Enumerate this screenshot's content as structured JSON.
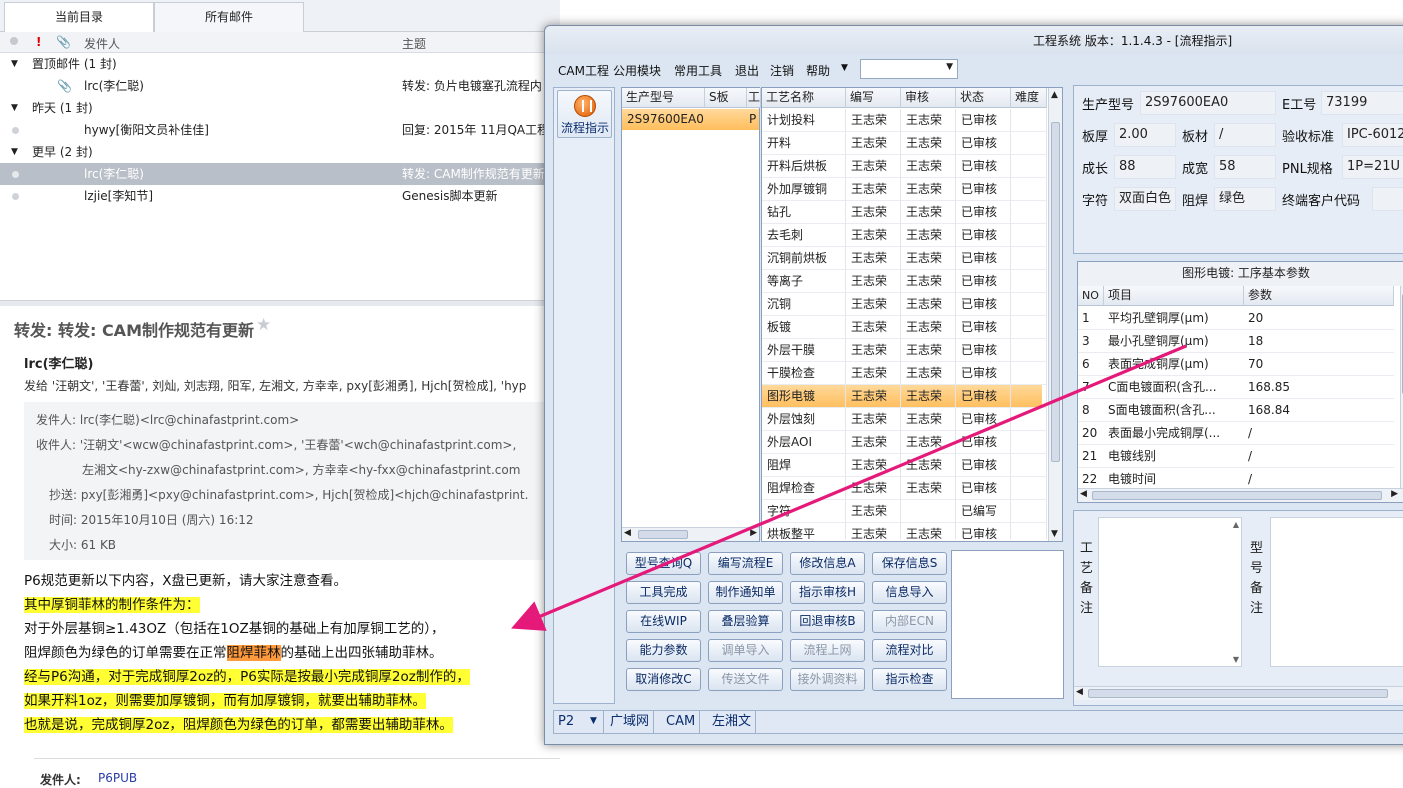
{
  "mail": {
    "tabs": [
      "当前目录",
      "所有邮件"
    ],
    "columns": {
      "sender": "发件人",
      "subject": "主题"
    },
    "groups": [
      {
        "label": "置顶邮件 (1 封)"
      },
      {
        "label": "昨天 (1 封)"
      },
      {
        "label": "更早 (2 封)"
      }
    ],
    "rows": [
      {
        "sender": "lrc(李仁聪)",
        "subject": "转发: 负片电镀塞孔流程内"
      },
      {
        "sender": "hywy[衡阳文员补佳佳]",
        "subject": "回复: 2015年 11月QA工程"
      },
      {
        "sender": "lrc(李仁聪)",
        "subject": "转发: CAM制作规范有更新"
      },
      {
        "sender": "lzjie[李知节]",
        "subject": "Genesis脚本更新"
      }
    ],
    "reading": {
      "subject": "转发: 转发: CAM制作规范有更新",
      "from": "lrc(李仁聪)",
      "to_line": "发给 '汪朝文', '王春蕾', 刘灿, 刘志翔, 阳军, 左湘文, 方幸幸, pxy[彭湘勇], Hjch[贺检成], 'hyp",
      "meta": {
        "sender": "发件人: lrc(李仁聪)<lrc@chinafastprint.com>",
        "recipients1": "收件人: '汪朝文'<wcw@chinafastprint.com>, '王春蕾'<wch@chinafastprint.com>,",
        "recipients2": "左湘文<hy-zxw@chinafastprint.com>, 方幸幸<hy-fxx@chinafastprint.com",
        "cc": "抄送: pxy[彭湘勇]<pxy@chinafastprint.com>, Hjch[贺检成]<hjch@chinafastprint.",
        "time": "时间: 2015年10月10日 (周六) 16:12",
        "size": "大小: 61 KB"
      },
      "body": {
        "l1": "P6规范更新以下内容，X盘已更新，请大家注意查看。",
        "l2": "其中厚铜菲林的制作条件为：",
        "l3": "对于外层基铜≥1.43OZ（包括在1OZ基铜的基础上有加厚铜工艺的），",
        "l4a": "阻焊颜色为绿色的订单需要在正常",
        "l4b": "阻焊菲林",
        "l4c": "的基础上出四张辅助菲林。",
        "l5": "经与P6沟通，对于完成铜厚2oz的，P6实际是按最小完成铜厚2oz制作的，",
        "l6": "如果开料1oz，则需要加厚镀铜，而有加厚镀铜，就要出辅助菲林。",
        "l7": "也就是说，完成铜厚2oz，阻焊颜色为绿色的订单，都需要出辅助菲林。"
      },
      "footer_label": "发件人:",
      "footer_value": "P6PUB"
    }
  },
  "app": {
    "title": "工程系统  版本：1.1.4.3 - [流程指示]",
    "menu": [
      "CAM工程",
      "公用模块",
      "常用工具",
      "退出",
      "注销",
      "帮助"
    ],
    "flow_button": "流程指示",
    "model_table": {
      "headers": [
        "生产型号",
        "S板",
        "工"
      ],
      "rows": [
        {
          "model": "2S97600EA0",
          "extra": "P"
        }
      ]
    },
    "process_table": {
      "headers": [
        "工艺名称",
        "编写",
        "审核",
        "状态",
        "难度"
      ],
      "rows": [
        [
          "计划投料",
          "王志荣",
          "王志荣",
          "已审核"
        ],
        [
          "开料",
          "王志荣",
          "王志荣",
          "已审核"
        ],
        [
          "开料后烘板",
          "王志荣",
          "王志荣",
          "已审核"
        ],
        [
          "外加厚镀铜",
          "王志荣",
          "王志荣",
          "已审核"
        ],
        [
          "钻孔",
          "王志荣",
          "王志荣",
          "已审核"
        ],
        [
          "去毛刺",
          "王志荣",
          "王志荣",
          "已审核"
        ],
        [
          "沉铜前烘板",
          "王志荣",
          "王志荣",
          "已审核"
        ],
        [
          "等离子",
          "王志荣",
          "王志荣",
          "已审核"
        ],
        [
          "沉铜",
          "王志荣",
          "王志荣",
          "已审核"
        ],
        [
          "板镀",
          "王志荣",
          "王志荣",
          "已审核"
        ],
        [
          "外层干膜",
          "王志荣",
          "王志荣",
          "已审核"
        ],
        [
          "干膜检查",
          "王志荣",
          "王志荣",
          "已审核"
        ],
        [
          "图形电镀",
          "王志荣",
          "王志荣",
          "已审核"
        ],
        [
          "外层蚀刻",
          "王志荣",
          "王志荣",
          "已审核"
        ],
        [
          "外层AOI",
          "王志荣",
          "王志荣",
          "已审核"
        ],
        [
          "阻焊",
          "王志荣",
          "王志荣",
          "已审核"
        ],
        [
          "阻焊检查",
          "王志荣",
          "王志荣",
          "已审核"
        ],
        [
          "字符",
          "王志荣",
          "",
          "已编写"
        ],
        [
          "烘板整平",
          "王志荣",
          "王志荣",
          "已审核"
        ]
      ],
      "selected_index": 12
    },
    "buttons": [
      [
        "型号查询Q",
        "编写流程E",
        "修改信息A",
        "保存信息S"
      ],
      [
        "工具完成",
        "制作通知单",
        "指示审核H",
        "信息导入"
      ],
      [
        "在线WIP",
        "叠层验算",
        "回退审核B",
        "内部ECN"
      ],
      [
        "能力参数",
        "调单导入",
        "流程上网",
        "流程对比"
      ],
      [
        "取消修改C",
        "传送文件",
        "接外调资料",
        "指示检查"
      ]
    ],
    "disabled_buttons": [
      "内部ECN",
      "调单导入",
      "流程上网",
      "传送文件",
      "接外调资料"
    ],
    "info": {
      "model_label": "生产型号",
      "model": "2S97600EA0",
      "eno_label": "E工号",
      "eno": "73199",
      "thick_label": "板厚",
      "thick": "2.00",
      "material_label": "板材",
      "material": "/",
      "std_label": "验收标准",
      "std": "IPC-6012",
      "len_label": "成长",
      "len": "88",
      "wid_label": "成宽",
      "wid": "58",
      "pnl_label": "PNL规格",
      "pnl": "1P=21U",
      "char_label": "字符",
      "char": "双面白色",
      "mask_label": "阻焊",
      "mask": "绿色",
      "cust_label": "终端客户代码",
      "cust": ""
    },
    "param_table": {
      "title": "图形电镀: 工序基本参数",
      "headers": [
        "NO",
        "项目",
        "参数"
      ],
      "rows": [
        [
          "1",
          "平均孔壁铜厚(μm)",
          "20"
        ],
        [
          "3",
          "最小孔壁铜厚(μm)",
          "18"
        ],
        [
          "6",
          "表面完成铜厚(μm)",
          "70"
        ],
        [
          "7",
          "C面电镀面积(含孔...",
          "168.85"
        ],
        [
          "8",
          "S面电镀面积(含孔...",
          "168.84"
        ],
        [
          "20",
          "表面最小完成铜厚(...",
          "/"
        ],
        [
          "21",
          "电镀线别",
          "/"
        ],
        [
          "22",
          "电镀时间",
          "/"
        ]
      ]
    },
    "notes": {
      "process": "工艺备注",
      "model": "型号备注"
    },
    "status": {
      "dropdown": "P2",
      "tabs": [
        "广域网",
        "CAM",
        "左湘文"
      ]
    }
  },
  "colors": {
    "highlight_yellow": "#ffff33",
    "highlight_orange": "#ff9a3c",
    "arrow": "#e5197a",
    "selected_row": "#ffbe5c"
  }
}
